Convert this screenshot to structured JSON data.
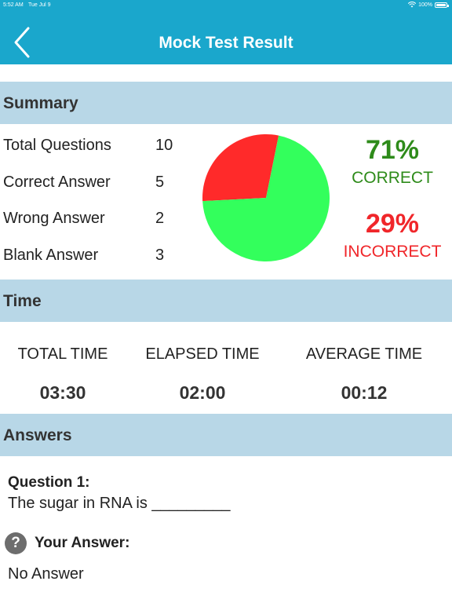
{
  "status_bar": {
    "time": "5:52 AM",
    "date": "Tue Jul 9",
    "battery": "100%"
  },
  "nav": {
    "title": "Mock Test Result"
  },
  "summary": {
    "header": "Summary",
    "rows": [
      {
        "label": "Total Questions",
        "value": "10"
      },
      {
        "label": "Correct Answer",
        "value": "5"
      },
      {
        "label": "Wrong Answer",
        "value": "2"
      },
      {
        "label": "Blank Answer",
        "value": "3"
      }
    ],
    "correct_percent": "71%",
    "correct_label": "CORRECT",
    "incorrect_percent": "29%",
    "incorrect_label": "INCORRECT"
  },
  "chart_data": {
    "type": "pie",
    "slices": [
      {
        "label": "CORRECT",
        "value": 71,
        "color": "#33ff5c"
      },
      {
        "label": "INCORRECT",
        "value": 29,
        "color": "#ff2a2a"
      }
    ]
  },
  "time": {
    "header": "Time",
    "total_label": "TOTAL TIME",
    "total_value": "03:30",
    "elapsed_label": "ELAPSED TIME",
    "elapsed_value": "02:00",
    "average_label": "AVERAGE TIME",
    "average_value": "00:12"
  },
  "answers": {
    "header": "Answers",
    "question_title": "Question 1:",
    "question_text": "The sugar in RNA is _________",
    "icon": "question-circle-icon",
    "icon_glyph": "?",
    "your_answer_label": "Your Answer:",
    "your_answer_value": "No Answer"
  },
  "colors": {
    "accent": "#1aa7cc",
    "section": "#b8d7e7",
    "correct": "#2e8b1a",
    "incorrect": "#f0262a"
  }
}
